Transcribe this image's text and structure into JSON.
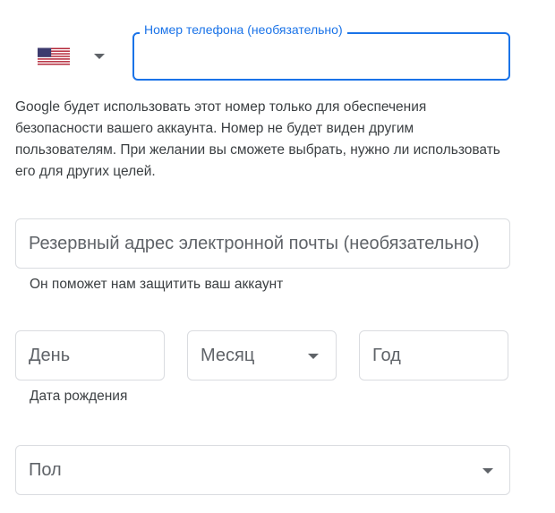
{
  "phone": {
    "country_flag": "us-flag-icon",
    "label": "Номер телефона (необязательно)",
    "value": "",
    "help_text": "Google будет использовать этот номер только для обеспечения безопасности вашего аккаунта. Номер не будет виден другим пользователям. При желании вы сможете выбрать, нужно ли использовать его для других целей."
  },
  "recovery_email": {
    "placeholder": "Резервный адрес электронной почты (необязательно)",
    "help_text": "Он поможет нам защитить ваш аккаунт"
  },
  "birthday": {
    "day_placeholder": "День",
    "month_placeholder": "Месяц",
    "year_placeholder": "Год",
    "help_text": "Дата рождения"
  },
  "gender": {
    "placeholder": "Пол"
  },
  "colors": {
    "accent": "#1a73e8",
    "border": "#dadce0",
    "text": "#202124",
    "secondary_text": "#5f6368"
  }
}
